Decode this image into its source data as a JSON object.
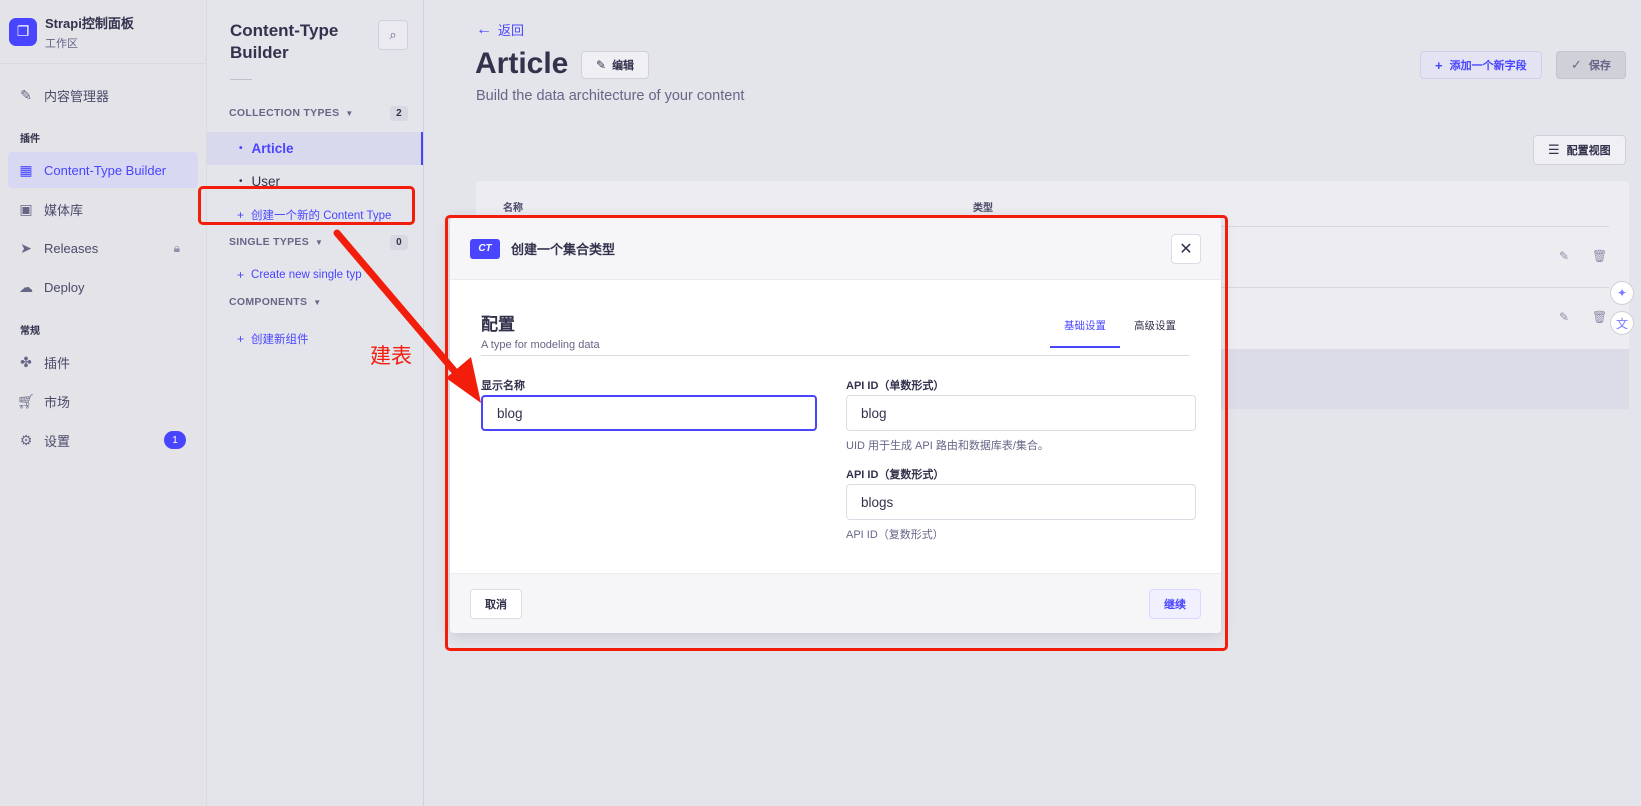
{
  "brand": {
    "title": "Strapi控制面板",
    "subtitle": "工作区",
    "logo_icon": "strapi-logo"
  },
  "nav": {
    "content_manager": "内容管理器",
    "section_plugins": "插件",
    "content_type_builder": "Content-Type Builder",
    "media_library": "媒体库",
    "releases": "Releases",
    "deploy": "Deploy",
    "section_general": "常规",
    "plugins": "插件",
    "marketplace": "市场",
    "settings": "设置",
    "settings_badge": "1"
  },
  "subnav": {
    "title": "Content-Type Builder",
    "collection_types": {
      "label": "COLLECTION TYPES",
      "count": "2",
      "items": [
        "Article",
        "User"
      ],
      "create_link": "创建一个新的 Content Type"
    },
    "single_types": {
      "label": "SINGLE TYPES",
      "count": "0",
      "create_link": "Create new single typ"
    },
    "components": {
      "label": "COMPONENTS",
      "create_link": "创建新组件"
    }
  },
  "main": {
    "back": "返回",
    "title": "Article",
    "edit": "编辑",
    "subtitle": "Build the data architecture of your content",
    "add_field": "添加一个新字段",
    "save": "保存",
    "config_view": "配置视图",
    "table_headers": [
      "名称",
      "类型"
    ]
  },
  "modal": {
    "badge": "CT",
    "title": "创建一个集合类型",
    "section_title": "配置",
    "section_subtitle": "A type for modeling data",
    "tabs": [
      "基础设置",
      "高级设置"
    ],
    "display_name_label": "显示名称",
    "display_name_value": "blog",
    "api_singular_label": "API ID（单数形式）",
    "api_singular_value": "blog",
    "api_singular_hint": "UID 用于生成 API 路由和数据库表/集合。",
    "api_plural_label": "API ID（复数形式）",
    "api_plural_value": "blogs",
    "api_plural_hint": "API ID（复数形式）",
    "cancel": "取消",
    "continue": "继续"
  },
  "annotation": {
    "text": "建表",
    "color": "#f21d0a"
  },
  "colors": {
    "primary": "#4945ff",
    "annotation_red": "#f21d0a"
  }
}
